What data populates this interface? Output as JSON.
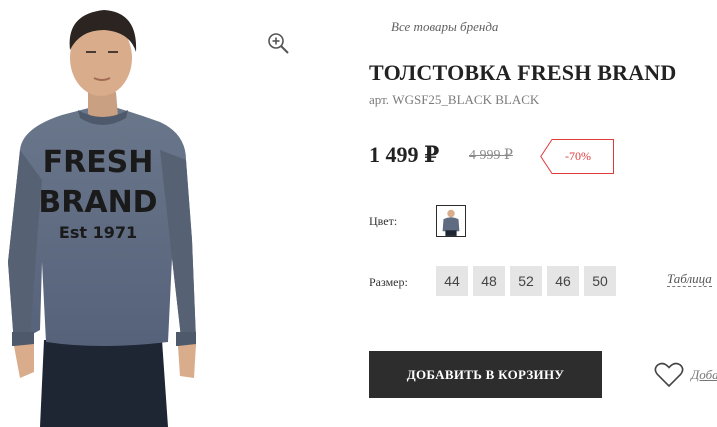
{
  "product": {
    "brand_link": "Все товары бренда",
    "title": "ТОЛСТОВКА FRESH BRAND",
    "sku": "арт. WGSF25_BLACK BLACK",
    "price": "1 499 ₽",
    "old_price": "4 999 ₽",
    "discount": "-70%",
    "sweater_print": [
      "FRESH",
      "BRAND",
      "Est 1971"
    ]
  },
  "color": {
    "label": "Цвет:"
  },
  "size": {
    "label": "Размер:",
    "options": [
      "44",
      "48",
      "52",
      "46",
      "50"
    ],
    "table_link": "Таблица"
  },
  "actions": {
    "add_to_cart": "ДОБАВИТЬ В КОРЗИНУ",
    "favorites": "Добавить"
  },
  "icons": {
    "zoom": "zoom-in-icon",
    "favorite": "heart-icon"
  },
  "colors": {
    "accent": "#e03b3b",
    "button_bg": "#2d2d2d",
    "size_chip_bg": "#e5e5e5",
    "sweater": "#5f6b80"
  }
}
